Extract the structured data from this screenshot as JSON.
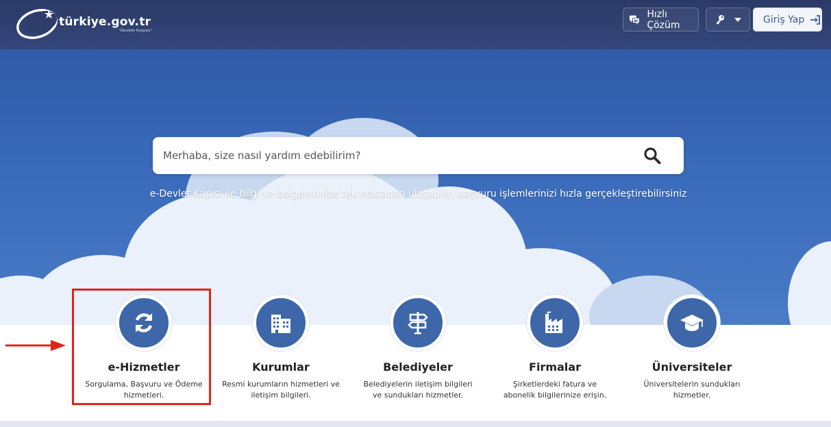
{
  "header": {
    "logo_text": "türkiye.gov.tr",
    "logo_sub": "\"Devletin Kısayolu\"",
    "hizli_cozum": "Hızlı Çözüm",
    "login_label": "Giriş Yap",
    "icons": [
      "chat-icon",
      "key-icon",
      "caret-down-icon",
      "sign-in-icon"
    ]
  },
  "search": {
    "placeholder": "Merhaba, size nasıl yardım edebilirim?"
  },
  "tagline": "e-Devlet Kapısı ile bilgi ve belgelerinize tek noktadan ulaşabilir, başvuru işlemlerinizi hızla gerçekleştirebilirsiniz",
  "categories": [
    {
      "title": "e-Hizmetler",
      "desc": "Sorgulama, Başvuru ve Ödeme hizmetleri.",
      "icon": "refresh-icon"
    },
    {
      "title": "Kurumlar",
      "desc": "Resmi kurumların hizmetleri ve iletişim bilgileri.",
      "icon": "building-icon"
    },
    {
      "title": "Belediyeler",
      "desc": "Belediyelerin iletişim bilgileri ve sundukları hizmetler.",
      "icon": "signpost-icon"
    },
    {
      "title": "Firmalar",
      "desc": "Şirketlerdeki fatura ve abonelik bilgilerinize erişin.",
      "icon": "factory-icon"
    },
    {
      "title": "Üniversiteler",
      "desc": "Üniversitelerin sundukları hizmetler.",
      "icon": "graduation-cap-icon"
    }
  ],
  "colors": {
    "header_bg": "#2b3a66",
    "accent": "#3d67a8",
    "highlight": "#e2231a"
  }
}
